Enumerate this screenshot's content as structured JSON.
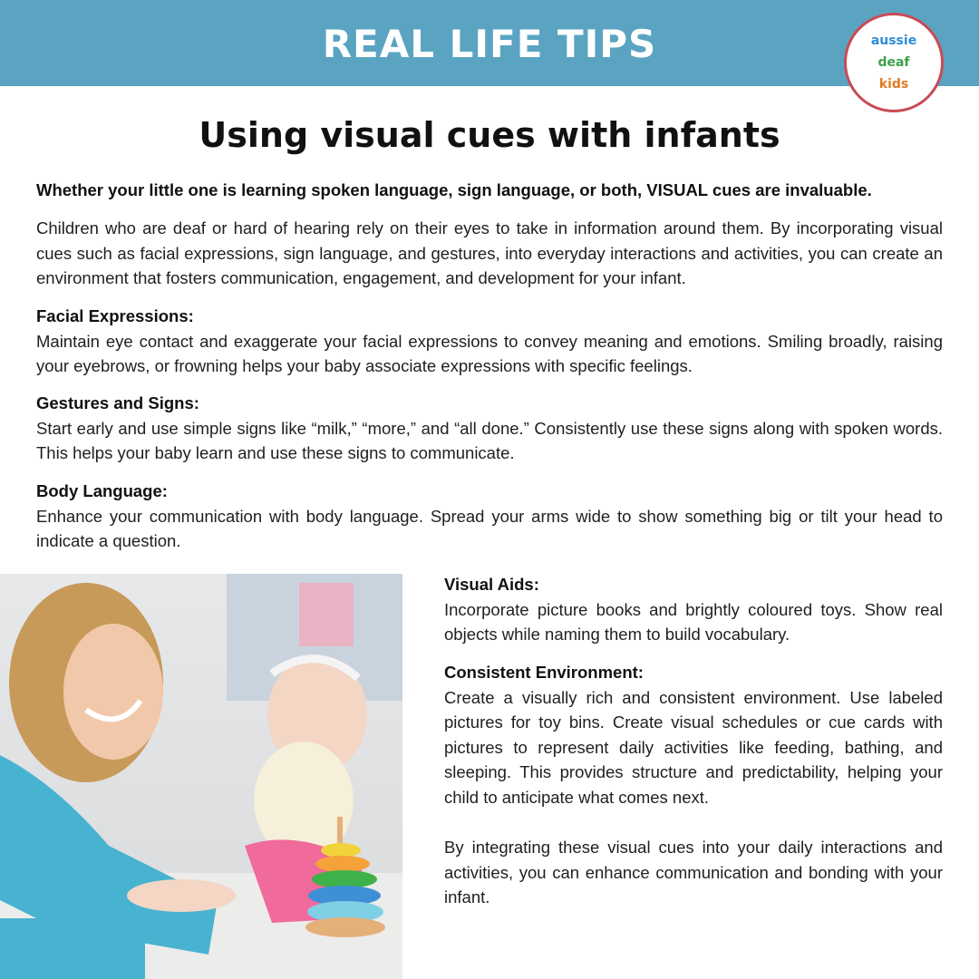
{
  "banner": {
    "title": "REAL LIFE TIPS"
  },
  "logo": {
    "line1": "aussie",
    "line2": "deaf",
    "line3": "kids"
  },
  "heading": "Using visual cues with infants",
  "lead": "Whether your little one is learning spoken language, sign language, or both, VISUAL cues are invaluable.",
  "intro": "Children who are deaf or hard of hearing rely on their eyes to take in information around them. By incorporating visual cues such as facial expressions, sign language, and gestures, into everyday interactions and activities, you can create an environment that fosters communication, engagement, and development for your infant.",
  "sections": [
    {
      "title": "Facial Expressions:",
      "body": "Maintain eye contact and exaggerate your facial expressions to convey meaning and emotions. Smiling broadly, raising your eyebrows, or frowning helps your baby associate expressions with specific feelings."
    },
    {
      "title": "Gestures and Signs:",
      "body": "Start early and use simple signs like “milk,” “more,” and “all done.” Consistently use these signs along with spoken words. This helps your baby learn and use these signs to communicate."
    },
    {
      "title": "Body Language:",
      "body": "Enhance your communication with body language. Spread your arms wide to show something big or tilt your head to indicate a question."
    },
    {
      "title": "Visual Aids:",
      "body": "Incorporate picture books and brightly coloured toys. Show real objects while naming them to build vocabulary."
    },
    {
      "title": "Consistent Environment:",
      "body": "Create a visually rich and consistent environment. Use labeled pictures for toy bins. Create visual schedules or cue cards with pictures to represent daily activities like feeding, bathing, and sleeping. This provides structure and predictability, helping your child to anticipate what comes next."
    }
  ],
  "closing": "By integrating these visual cues into your daily interactions and activities, you can enhance communication and bonding with your infant.",
  "colors": {
    "banner": "#5aa4c2",
    "logo_border": "#c94b55"
  }
}
